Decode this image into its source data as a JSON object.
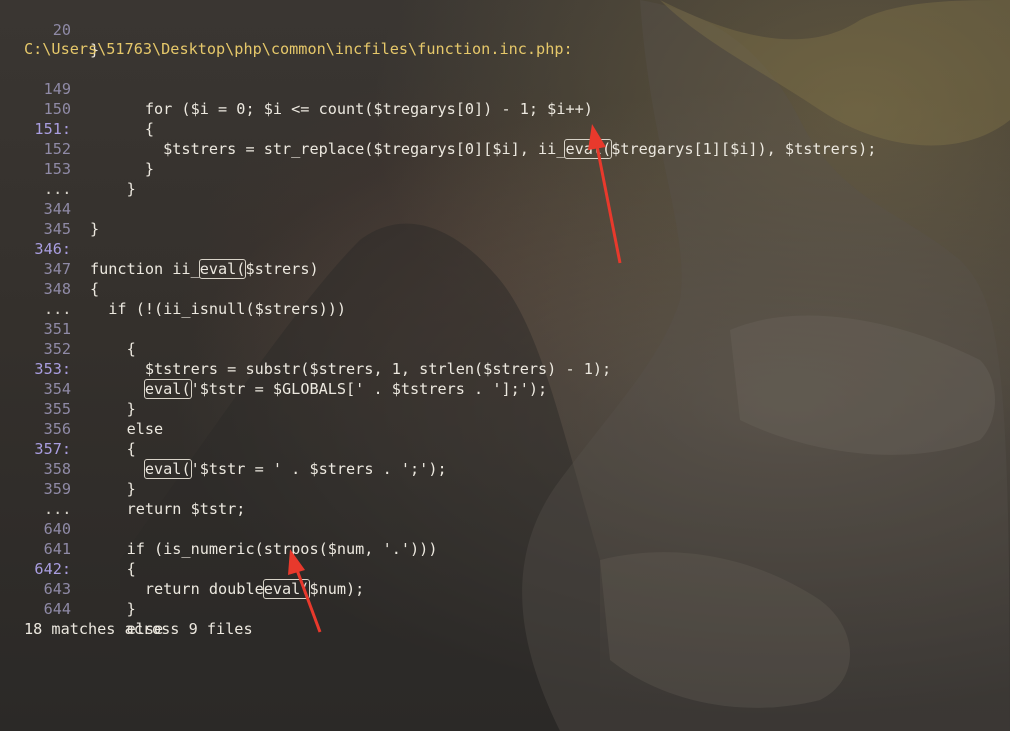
{
  "file_path": "C:\\Users\\51763\\Desktop\\php\\common\\incfiles\\function.inc.php:",
  "summary": "18 matches across 9 files",
  "lines": [
    {
      "num": "20",
      "match": false,
      "pre": "}",
      "hl": "",
      "post": ""
    },
    {
      "num": "149",
      "match": false,
      "pre": "      for ($i = 0; $i <= count($tregarys[0]) - 1; $i++)",
      "hl": "",
      "post": ""
    },
    {
      "num": "150",
      "match": false,
      "pre": "      {",
      "hl": "",
      "post": ""
    },
    {
      "num": "151:",
      "match": true,
      "pre": "        $tstrers = str_replace($tregarys[0][$i], ii_",
      "hl": "eval(",
      "post": "$tregarys[1][$i]), $tstrers);"
    },
    {
      "num": "152",
      "match": false,
      "pre": "      }",
      "hl": "",
      "post": ""
    },
    {
      "num": "153",
      "match": false,
      "pre": "    }",
      "hl": "",
      "post": ""
    },
    {
      "num": "344",
      "match": false,
      "pre": "}",
      "hl": "",
      "post": ""
    },
    {
      "num": "345",
      "match": false,
      "pre": "",
      "hl": "",
      "post": ""
    },
    {
      "num": "346:",
      "match": true,
      "pre": "function ii_",
      "hl": "eval(",
      "post": "$strers)"
    },
    {
      "num": "347",
      "match": false,
      "pre": "{",
      "hl": "",
      "post": ""
    },
    {
      "num": "348",
      "match": false,
      "pre": "  if (!(ii_isnull($strers)))",
      "hl": "",
      "post": ""
    },
    {
      "num": "351",
      "match": false,
      "pre": "    {",
      "hl": "",
      "post": ""
    },
    {
      "num": "352",
      "match": false,
      "pre": "      $tstrers = substr($strers, 1, strlen($strers) - 1);",
      "hl": "",
      "post": ""
    },
    {
      "num": "353:",
      "match": true,
      "pre": "      ",
      "hl": "eval(",
      "post": "'$tstr = $GLOBALS[' . $tstrers . '];');"
    },
    {
      "num": "354",
      "match": false,
      "pre": "    }",
      "hl": "",
      "post": ""
    },
    {
      "num": "355",
      "match": false,
      "pre": "    else",
      "hl": "",
      "post": ""
    },
    {
      "num": "356",
      "match": false,
      "pre": "    {",
      "hl": "",
      "post": ""
    },
    {
      "num": "357:",
      "match": true,
      "pre": "      ",
      "hl": "eval(",
      "post": "'$tstr = ' . $strers . ';');"
    },
    {
      "num": "358",
      "match": false,
      "pre": "    }",
      "hl": "",
      "post": ""
    },
    {
      "num": "359",
      "match": false,
      "pre": "    return $tstr;",
      "hl": "",
      "post": ""
    },
    {
      "num": "640",
      "match": false,
      "pre": "    if (is_numeric(strpos($num, '.')))",
      "hl": "",
      "post": ""
    },
    {
      "num": "641",
      "match": false,
      "pre": "    {",
      "hl": "",
      "post": ""
    },
    {
      "num": "642:",
      "match": true,
      "pre": "      return double",
      "hl": "eval(",
      "post": "$num);"
    },
    {
      "num": "643",
      "match": false,
      "pre": "    }",
      "hl": "",
      "post": ""
    },
    {
      "num": "644",
      "match": false,
      "pre": "    else",
      "hl": "",
      "post": ""
    }
  ],
  "ellipsis": "...",
  "arrow_color": "#e8392c"
}
